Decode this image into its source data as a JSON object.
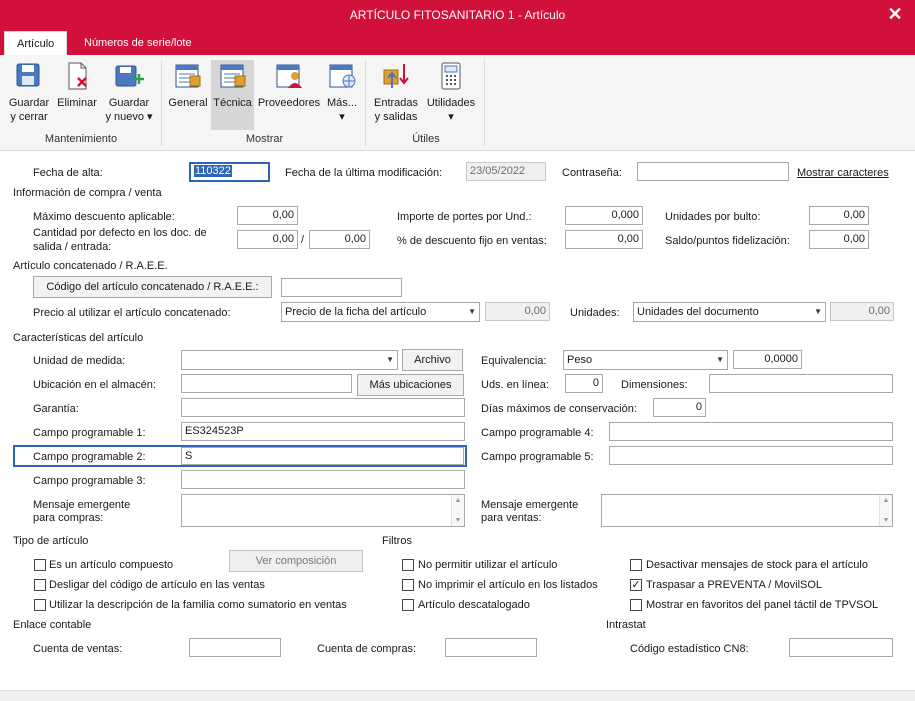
{
  "window": {
    "title": "ARTÍCULO FITOSANITARIO 1 - Artículo",
    "close_icon": "✕"
  },
  "tabs": [
    {
      "label": "Artículo"
    },
    {
      "label": "Números de serie/lote"
    }
  ],
  "ribbon": {
    "groups": [
      {
        "label": "Mantenimiento"
      },
      {
        "label": "Mostrar"
      },
      {
        "label": "Útiles"
      }
    ],
    "buttons": {
      "guardar_cerrar": {
        "line1": "Guardar",
        "line2": "y cerrar"
      },
      "eliminar": {
        "line1": "Eliminar"
      },
      "guardar_nuevo": {
        "line1": "Guardar",
        "line2": "y nuevo ▾"
      },
      "general": {
        "line1": "General"
      },
      "tecnica": {
        "line1": "Técnica"
      },
      "proveedores": {
        "line1": "Proveedores"
      },
      "mas": {
        "line1": "Más...",
        "line2": "▾"
      },
      "entradas_salidas": {
        "line1": "Entradas",
        "line2": "y salidas"
      },
      "utilidades": {
        "line1": "Utilidades",
        "line2": "▾"
      }
    }
  },
  "header": {
    "fecha_alta_label": "Fecha de alta:",
    "fecha_alta_value": "110322",
    "ultima_mod_label": "Fecha de la última modificación:",
    "ultima_mod_value": "23/05/2022",
    "contrasena_label": "Contraseña:",
    "contrasena_value": "",
    "mostrar_caracteres": "Mostrar caracteres"
  },
  "compra_venta": {
    "section": "Información de compra / venta",
    "max_descuento_label": "Máximo descuento aplicable:",
    "max_descuento_value": "0,00",
    "cantidad_defecto_label1": "Cantidad por defecto en los doc. de",
    "cantidad_defecto_label2": "salida / entrada:",
    "cantidad_salida_value": "0,00",
    "cantidad_separator": "/",
    "cantidad_entrada_value": "0,00",
    "portes_label": "Importe de portes por Und.:",
    "portes_value": "0,000",
    "descuento_fijo_label": "% de descuento fijo en ventas:",
    "descuento_fijo_value": "0,00",
    "unidades_bulto_label": "Unidades por bulto:",
    "unidades_bulto_value": "0,00",
    "saldo_puntos_label": "Saldo/puntos fidelización:",
    "saldo_puntos_value": "0,00"
  },
  "concatenado": {
    "section": "Artículo concatenado / R.A.E.E.",
    "codigo_button": "Código del artículo concatenado / R.A.E.E.:",
    "codigo_value": "",
    "precio_label": "Precio al utilizar el artículo concatenado:",
    "precio_select": "Precio de la ficha del artículo",
    "precio_value": "0,00",
    "unidades_label": "Unidades:",
    "unidades_select": "Unidades del documento",
    "unidades_value": "0,00"
  },
  "caracteristicas": {
    "section": "Características del artículo",
    "unidad_medida_label": "Unidad de medida:",
    "unidad_medida_value": "",
    "archivo_button": "Archivo",
    "ubicacion_label": "Ubicación en el almacén:",
    "ubicacion_value": "",
    "mas_ubicaciones_button": "Más ubicaciones",
    "garantia_label": "Garantía:",
    "garantia_value": "",
    "campo1_label": "Campo programable 1:",
    "campo1_value": "ES324523P",
    "campo2_label": "Campo programable 2:",
    "campo2_value": "S",
    "campo3_label": "Campo programable 3:",
    "campo3_value": "",
    "mensaje_compras_label1": "Mensaje emergente",
    "mensaje_compras_label2": "para compras:",
    "equivalencia_label": "Equivalencia:",
    "equivalencia_select": "Peso",
    "equivalencia_value": "0,0000",
    "uds_linea_label": "Uds. en línea:",
    "uds_linea_value": "0",
    "dimensiones_label": "Dimensiones:",
    "dimensiones_value": "",
    "dias_max_label": "Días máximos de conservación:",
    "dias_max_value": "0",
    "campo4_label": "Campo programable 4:",
    "campo4_value": "",
    "campo5_label": "Campo programable 5:",
    "campo5_value": "",
    "mensaje_ventas_label1": "Mensaje emergente",
    "mensaje_ventas_label2": "para ventas:"
  },
  "tipo_articulo": {
    "section": "Tipo de artículo",
    "compuesto": {
      "label": "Es un artículo compuesto",
      "checked": false
    },
    "ver_composicion_button": "Ver composición",
    "desligar": {
      "label": "Desligar del código de artículo en las ventas",
      "checked": false
    },
    "descripcion_familia": {
      "label": "Utilizar la descripción de la familia como sumatorio en ventas",
      "checked": false
    }
  },
  "filtros": {
    "section": "Filtros",
    "no_permitir": {
      "label": "No permitir utilizar el artículo",
      "checked": false
    },
    "no_imprimir": {
      "label": "No imprimir el artículo en los listados",
      "checked": false
    },
    "descatalogado": {
      "label": "Artículo descatalogado",
      "checked": false
    },
    "desactivar_stock": {
      "label": "Desactivar mensajes de stock para el artículo",
      "checked": false
    },
    "traspasar_preventa": {
      "label": "Traspasar a PREVENTA / MovilSOL",
      "checked": true
    },
    "mostrar_favoritos": {
      "label": "Mostrar en favoritos del panel táctil de TPVSOL",
      "checked": false
    },
    "check_mark": "✓"
  },
  "enlace_contable": {
    "section": "Enlace contable",
    "cuenta_ventas_label": "Cuenta de ventas:",
    "cuenta_ventas_value": "",
    "cuenta_compras_label": "Cuenta de compras:",
    "cuenta_compras_value": ""
  },
  "intrastat": {
    "section": "Intrastat",
    "codigo_cn8_label": "Código estadístico CN8:",
    "codigo_cn8_value": ""
  },
  "colors": {
    "accent": "#d2103c",
    "focus": "#2f65b5"
  }
}
